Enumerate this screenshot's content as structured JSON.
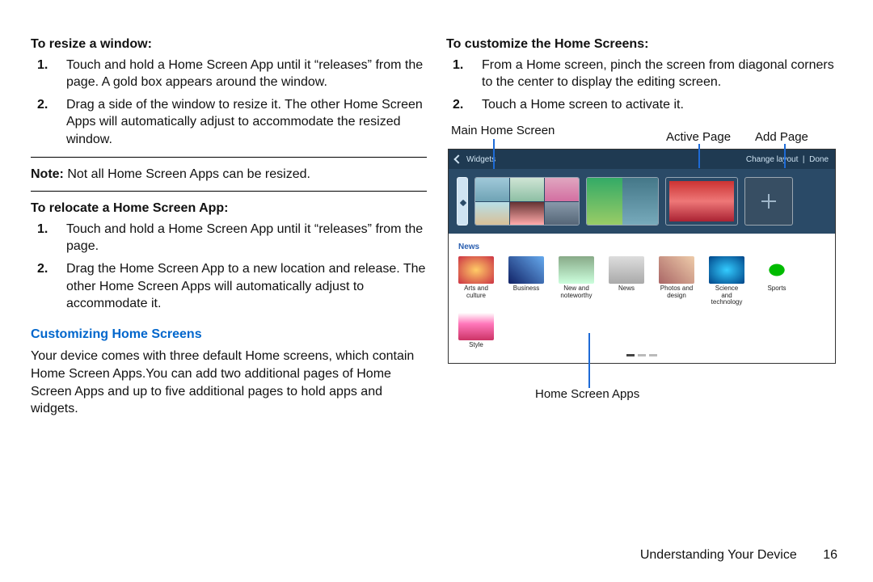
{
  "left": {
    "resize_h": "To resize a window:",
    "resize_steps": [
      "Touch and hold a Home Screen App until it “releases” from the page. A gold box appears around the window.",
      "Drag a side of the window to resize it. The other Home Screen Apps will automatically adjust to accommodate the resized window."
    ],
    "note_prefix": "Note:",
    "note_body": " Not all Home Screen Apps can be resized.",
    "relocate_h": "To relocate a Home Screen App:",
    "relocate_steps": [
      "Touch and hold a Home Screen App until it “releases” from the page.",
      "Drag the Home Screen App to a new location and release. The other Home Screen Apps will automatically adjust to accommodate it."
    ],
    "custom_h": "Customizing Home Screens",
    "custom_p": "Your device comes with three default Home screens, which contain Home Screen Apps.You can add two additional pages of Home Screen Apps and up to five additional pages to hold apps and widgets."
  },
  "right": {
    "customize_h": "To customize the Home Screens:",
    "customize_steps": [
      "From a Home screen, pinch the screen from diagonal corners to the center to display the editing screen.",
      "Touch a Home screen to activate it."
    ],
    "labels": {
      "main": "Main Home Screen",
      "active": "Active Page",
      "add": "Add Page",
      "apps": "Home Screen Apps"
    },
    "topbar": {
      "widgets": "Widgets",
      "change": "Change layout",
      "done": "Done"
    },
    "section": "News",
    "categories": [
      "Arts and culture",
      "Business",
      "New and noteworthy",
      "News",
      "Photos and design",
      "Science and technology",
      "Sports",
      "Style"
    ]
  },
  "footer": {
    "section": "Understanding Your Device",
    "page": "16"
  }
}
